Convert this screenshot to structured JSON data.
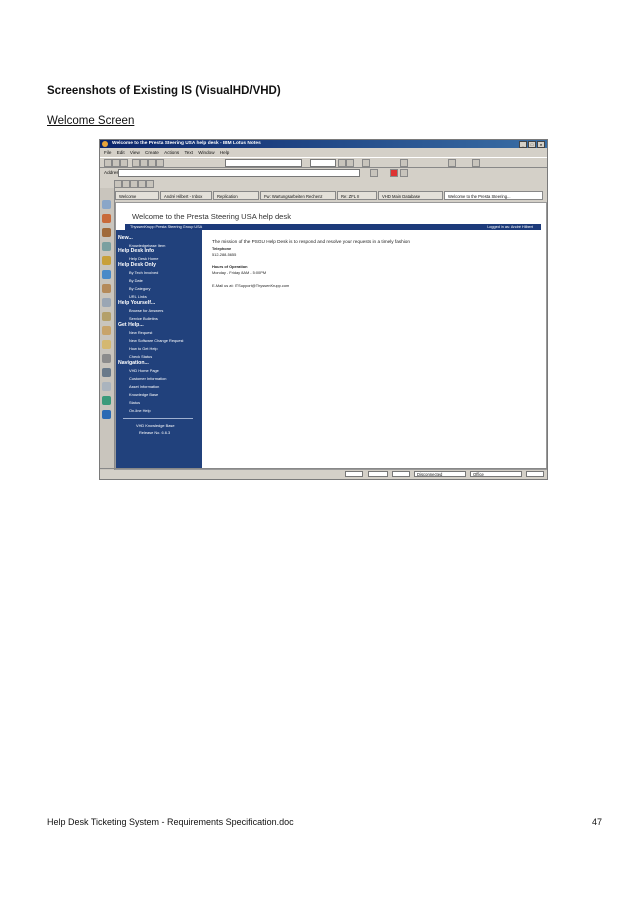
{
  "document": {
    "heading": "Screenshots of Existing IS (VisualHD/VHD)",
    "subheading": "Welcome Screen",
    "footer_left": "Help Desk Ticketing System - Requirements Specification.doc",
    "page_number": "47"
  },
  "screenshot": {
    "window_title": "Welcome to the Presta Steering USA help desk - IBM Lotus Notes",
    "window_buttons": [
      "_",
      "□",
      "×"
    ],
    "menu": [
      "File",
      "Edit",
      "View",
      "Create",
      "Actions",
      "Text",
      "Window",
      "Help"
    ],
    "address_label": "Address",
    "tabs": [
      "Welcome",
      "André Hilbert - Inbox",
      "Replication",
      "Fw: Wartungsarbeiten Rechenz",
      "Re: ZFL II",
      "VHD Main Database",
      "Welcome to the Presta Steering..."
    ],
    "banner_title": "Welcome to the Presta Steering USA help desk",
    "banner_left": "ThyssenKrupp Presta Steering Group USA",
    "banner_right": "Logged in as: André Hilbert",
    "nav": {
      "new_heading": "New...",
      "new_items": [
        "Knowledgebase Item"
      ],
      "help_desk_info_heading": "Help Desk Info",
      "help_desk_info_items": [
        "Help Desk Home"
      ],
      "help_desk_only_heading": "Help Desk Only",
      "help_desk_only_items": [
        "By Tech Involved",
        "By Date",
        "By Category",
        "URL Links"
      ],
      "help_yourself_heading": "Help Yourself...",
      "help_yourself_items": [
        "Browse for Answers",
        "Service Bulletins"
      ],
      "get_help_heading": "Get Help...",
      "get_help_items": [
        "New Request",
        "New Software Change Request",
        "How to Get Help",
        "Check Status"
      ],
      "navigation_heading": "Navigation...",
      "navigation_items": [
        "VHD Home Page",
        "Customer Information",
        "Asset Information",
        "Knowledge Base",
        "Status",
        "On-line Help"
      ],
      "release_line1": "VHD Knowledge Base",
      "release_line2": "Release No. 6.6.3"
    },
    "main": {
      "mission": "The mission of the PSGU Help Desk  is to respond  and  resolve  your requests in a timely fashion",
      "telephone_label": "Telephone",
      "telephone_value": "512-288-5655",
      "hours_label": "Hours of Operation",
      "hours_value": "Monday - Friday 8AM - 5:00PM",
      "email_line": "E-Mail us at: ITSupport@ThyssenKrupp.com"
    },
    "status": {
      "connection": "Disconnected",
      "location": "Office"
    }
  }
}
